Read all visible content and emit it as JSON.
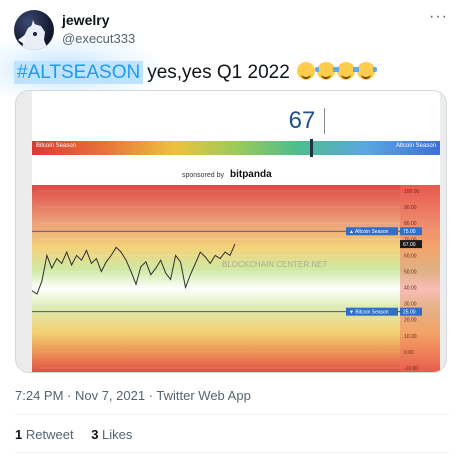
{
  "author": {
    "name": "jewelry",
    "handle": "@execut333"
  },
  "tweet": {
    "hashtag": "#ALTSEASON",
    "text": "yes,yes Q1 2022",
    "emojis": [
      "relieved-face-icon",
      "tears-of-joy-icon",
      "tears-of-joy-icon",
      "tears-of-joy-icon"
    ]
  },
  "menu_icon": "more-icon",
  "meta": {
    "time": "7:24 PM · Nov 7, 2021 · Twitter Web App"
  },
  "stats": {
    "retweets_count": "1",
    "retweets_label": "Retweet",
    "likes_count": "3",
    "likes_label": "Likes"
  },
  "image": {
    "index_value": "67",
    "bar_left_label": "Bitcoin Season",
    "bar_right_label": "Altcoin Season",
    "sponsored_by": "sponsored by",
    "sponsor_name": "bitpanda",
    "watermark": "BLOCKCHAIN CENTER.NET",
    "altcoin_line_label": "▲ Altcoin Season",
    "bitcoin_line_label": "▼ Bitcoin Season"
  },
  "colors": {
    "accent": "#1d9bf0",
    "hashtag_highlight": "#bfe3ff",
    "text_primary": "#0f1419",
    "text_secondary": "#536471",
    "index_blue": "#21508a"
  },
  "chart_data": {
    "type": "line",
    "ylim": [
      -10,
      100
    ],
    "y_ticks": [
      "100.00",
      "90.00",
      "80.00",
      "70.00",
      "60.00",
      "50.00",
      "40.00",
      "30.00",
      "20.00",
      "10.00",
      "0.00",
      "-10.00"
    ],
    "reference_lines": [
      {
        "label": "▲ Altcoin Season",
        "value_label": "75.00",
        "value": 75
      },
      {
        "label": "▼ Bitcoin Season",
        "value_label": "25.00",
        "value": 25
      }
    ],
    "current_value_label": "67.00",
    "current_value": 67,
    "series": [
      {
        "values": [
          38,
          36,
          44,
          60,
          52,
          58,
          55,
          62,
          54,
          60,
          57,
          63,
          55,
          58,
          50,
          56,
          60,
          65,
          62,
          57,
          50,
          42,
          53,
          56,
          48,
          52,
          57,
          49,
          45,
          60,
          56,
          40,
          48,
          55,
          62,
          59,
          55,
          60,
          58,
          62,
          60,
          67
        ]
      }
    ]
  }
}
